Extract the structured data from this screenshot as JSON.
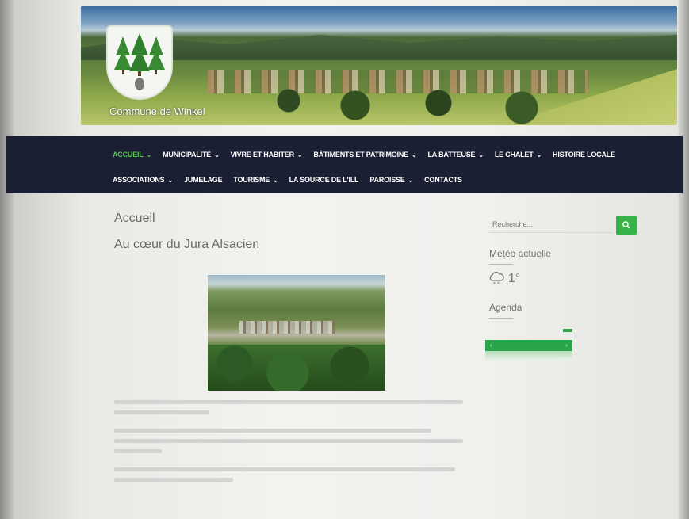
{
  "site": {
    "name": "Commune de Winkel"
  },
  "nav": {
    "row1": [
      {
        "label": "Accueil",
        "has_dropdown": true,
        "active": true
      },
      {
        "label": "Municipalité",
        "has_dropdown": true,
        "active": false
      },
      {
        "label": "Vivre et habiter",
        "has_dropdown": true,
        "active": false
      },
      {
        "label": "Bâtiments et patrimoine",
        "has_dropdown": true,
        "active": false
      },
      {
        "label": "La Batteuse",
        "has_dropdown": true,
        "active": false
      },
      {
        "label": "Le Chalet",
        "has_dropdown": true,
        "active": false
      },
      {
        "label": "Histoire locale",
        "has_dropdown": false,
        "active": false
      }
    ],
    "row2": [
      {
        "label": "Associations",
        "has_dropdown": true,
        "active": false
      },
      {
        "label": "Jumelage",
        "has_dropdown": false,
        "active": false
      },
      {
        "label": "Tourisme",
        "has_dropdown": true,
        "active": false
      },
      {
        "label": "La source de l'Ill",
        "has_dropdown": false,
        "active": false
      },
      {
        "label": "Paroisse",
        "has_dropdown": true,
        "active": false
      },
      {
        "label": "Contacts",
        "has_dropdown": false,
        "active": false
      }
    ]
  },
  "main": {
    "title": "Accueil",
    "subtitle": "Au cœur du Jura Alsacien"
  },
  "sidebar": {
    "search_placeholder": "Recherche...",
    "weather_title": "Météo actuelle",
    "weather_icon": "cloud-snow-icon",
    "weather_temp": "1°",
    "agenda_title": "Agenda"
  },
  "colors": {
    "nav_bg": "#1b1f33",
    "accent_green": "#38b24a",
    "active_nav": "#5cc05a"
  }
}
